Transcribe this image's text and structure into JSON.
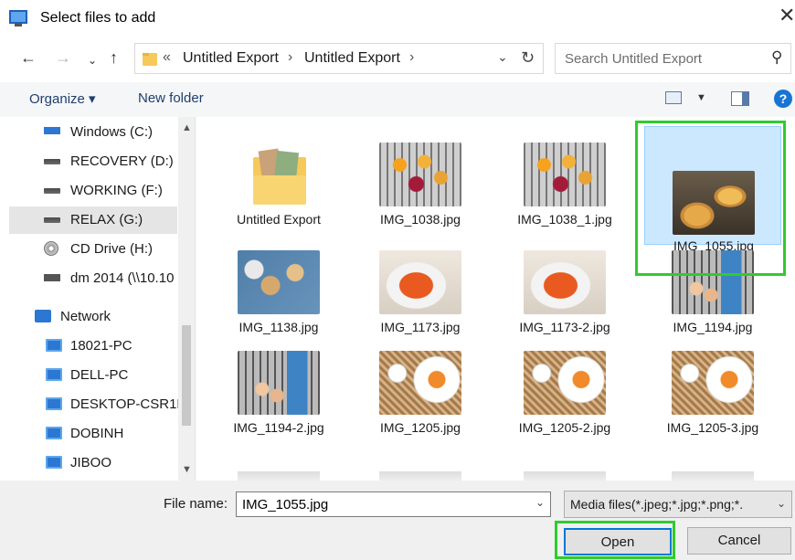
{
  "window": {
    "title": "Select files to add"
  },
  "address": {
    "breadcrumbs": [
      "Untitled Export",
      "Untitled Export"
    ],
    "overflow_glyph": "«"
  },
  "search": {
    "placeholder": "Search Untitled Export"
  },
  "toolbar": {
    "organize_label": "Organize ▾",
    "new_folder_label": "New folder"
  },
  "nav_pane": {
    "items": [
      {
        "label": "Windows (C:)",
        "icon": "windows-drive-icon"
      },
      {
        "label": "RECOVERY (D:)",
        "icon": "drive-icon"
      },
      {
        "label": "WORKING (F:)",
        "icon": "drive-icon"
      },
      {
        "label": "RELAX (G:)",
        "icon": "drive-icon",
        "selected": true
      },
      {
        "label": "CD Drive (H:)",
        "icon": "cd-drive-icon"
      },
      {
        "label": "dm 2014 (\\\\10.10",
        "icon": "network-drive-icon"
      },
      {
        "label": "Network",
        "icon": "network-icon"
      },
      {
        "label": "18021-PC",
        "icon": "computer-icon"
      },
      {
        "label": "DELL-PC",
        "icon": "computer-icon"
      },
      {
        "label": "DESKTOP-CSR1F",
        "icon": "computer-icon"
      },
      {
        "label": "DOBINH",
        "icon": "computer-icon"
      },
      {
        "label": "JIBOO",
        "icon": "computer-icon"
      }
    ]
  },
  "files": [
    {
      "name": "Untitled Export",
      "kind": "folder"
    },
    {
      "name": "IMG_1038.jpg",
      "thumb": "bake"
    },
    {
      "name": "IMG_1038_1.jpg",
      "thumb": "bake"
    },
    {
      "name": "IMG_1055.jpg",
      "thumb": "tart",
      "selected": true
    },
    {
      "name": "IMG_1138.jpg",
      "thumb": "blue"
    },
    {
      "name": "IMG_1173.jpg",
      "thumb": "pasta"
    },
    {
      "name": "IMG_1173-2.jpg",
      "thumb": "pasta"
    },
    {
      "name": "IMG_1194.jpg",
      "thumb": "eggs"
    },
    {
      "name": "IMG_1194-2.jpg",
      "thumb": "eggs"
    },
    {
      "name": "IMG_1205.jpg",
      "thumb": "plate"
    },
    {
      "name": "IMG_1205-2.jpg",
      "thumb": "plate"
    },
    {
      "name": "IMG_1205-3.jpg",
      "thumb": "plate"
    }
  ],
  "bottom": {
    "file_name_label": "File name:",
    "file_name_value": "IMG_1055.jpg",
    "file_type": "Media files(*.jpeg;*.jpg;*.png;*.",
    "open_label": "Open",
    "cancel_label": "Cancel"
  },
  "colors": {
    "highlight": "#2ecc2e",
    "selection": "#cce8ff",
    "accent": "#0078d7"
  }
}
